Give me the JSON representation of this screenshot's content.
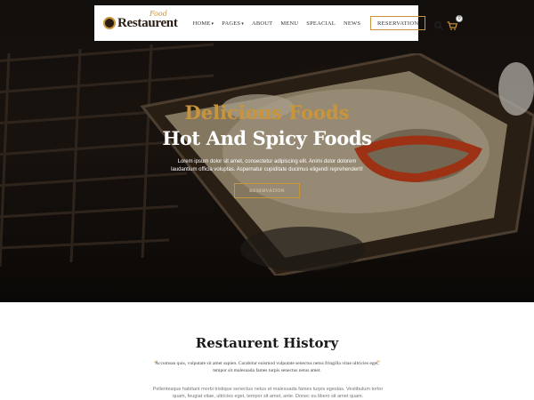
{
  "brand": {
    "name": "Restaurent",
    "script": "Food",
    "accent": "#c9953b"
  },
  "nav": {
    "items": [
      {
        "label": "HOME",
        "has_dropdown": true
      },
      {
        "label": "PAGES",
        "has_dropdown": true
      },
      {
        "label": "ABOUT",
        "has_dropdown": false
      },
      {
        "label": "MENU",
        "has_dropdown": false
      },
      {
        "label": "SPEACIAL",
        "has_dropdown": false
      },
      {
        "label": "NEWS",
        "has_dropdown": false
      }
    ],
    "caret": "▾",
    "reservation_label": "RESERVATION",
    "cart_count": "0"
  },
  "hero": {
    "subtitle": "Delicious Foods",
    "title": "Hot And Spicy Foods",
    "text": "Lorem ipsum dolor sit amet, consectetur adipiscing elit. Animi dolor dolorem laudantium officia voluptas. Aspernatur cupiditate ducimus eligendi reprehenderit!",
    "button_label": "RESERVATION"
  },
  "history": {
    "title": "Restaurent History",
    "quote": "Accumsan quis, vulputate sit amet sapien. Curabitur euismod vulputate senectus netus fringilla vitae ultricies eget, tempor sit malesuada fames turpis senectus netus amet.",
    "text": "Pellentesque habitant morbi tristique senectus netus et malesuada fames turpis egestas. Vestibulum tortor quam, feugiat vitae, ultricies eget, tempor sit amet, ante. Donec eu libero sit amet quam."
  }
}
